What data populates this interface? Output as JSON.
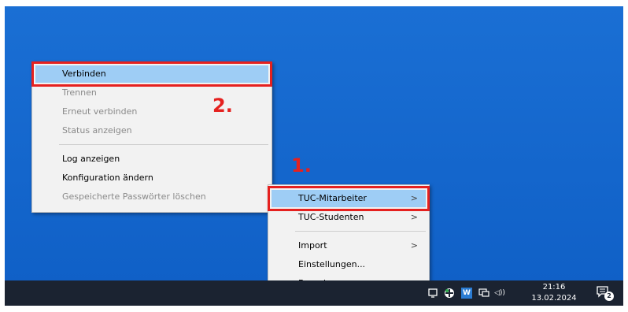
{
  "context_menu": {
    "items": [
      {
        "label": "Verbinden",
        "enabled": true,
        "highlighted": true
      },
      {
        "label": "Trennen",
        "enabled": false
      },
      {
        "label": "Erneut verbinden",
        "enabled": false
      },
      {
        "label": "Status anzeigen",
        "enabled": false
      },
      {
        "label": "Log anzeigen",
        "enabled": true
      },
      {
        "label": "Konfiguration ändern",
        "enabled": true
      },
      {
        "label": "Gespeicherte Passwörter löschen",
        "enabled": false
      }
    ]
  },
  "tray_menu": {
    "items": [
      {
        "label": "TUC-Mitarbeiter",
        "submenu": true,
        "highlighted": true
      },
      {
        "label": "TUC-Studenten",
        "submenu": true
      },
      {
        "label": "Import",
        "submenu": true
      },
      {
        "label": "Einstellungen...",
        "submenu": false
      },
      {
        "label": "Beenden",
        "submenu": false
      }
    ],
    "submenu_arrow": ">"
  },
  "annotations": {
    "step1": "1.",
    "step2": "2."
  },
  "taskbar": {
    "clock_time": "21:16",
    "clock_date": "13.02.2024",
    "notification_count": "2",
    "word_icon_letter": "W",
    "volume_glyph": "◁))"
  },
  "colors": {
    "desktop": "#1466cc",
    "highlight": "#9ecdf5",
    "annotation_red": "#e5211f",
    "taskbar": "#1b2331"
  }
}
